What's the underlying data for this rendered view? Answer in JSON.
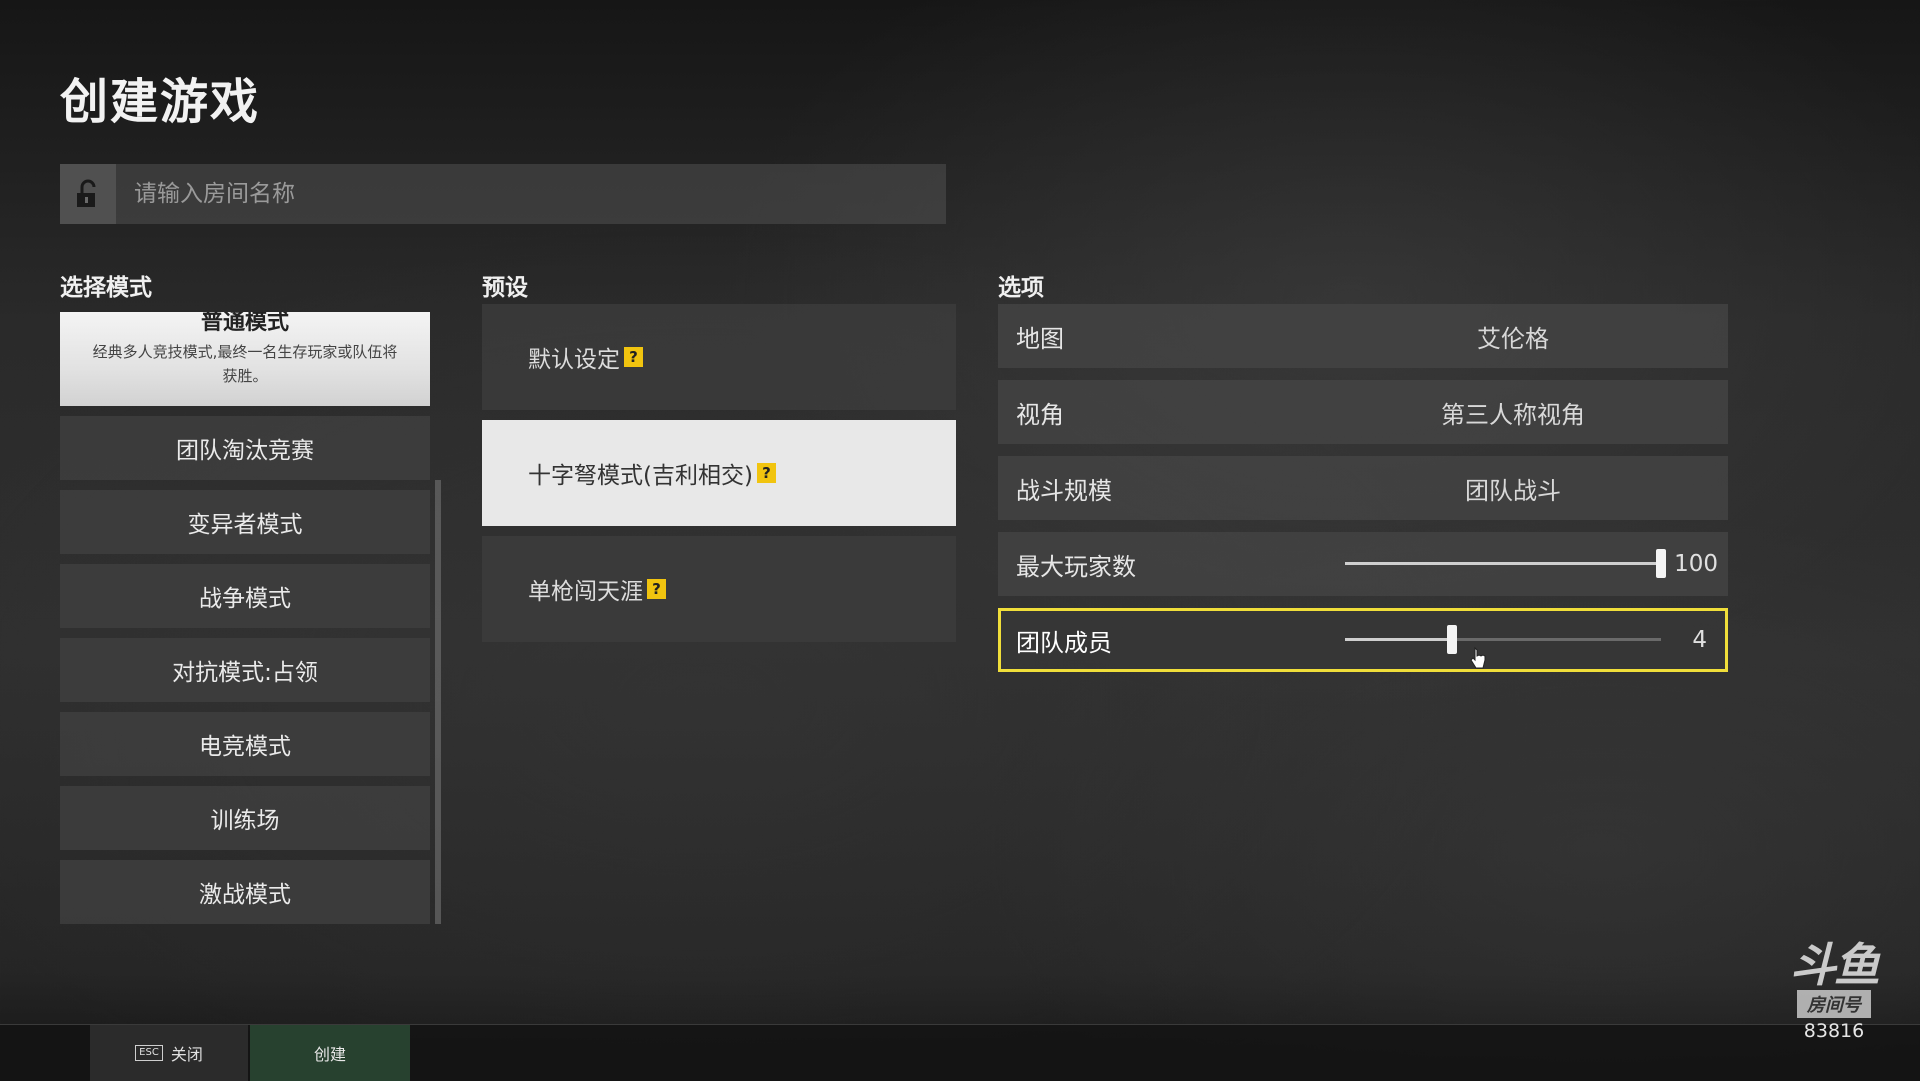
{
  "header": {
    "title": "创建游戏"
  },
  "room": {
    "placeholder": "请输入房间名称",
    "value": ""
  },
  "modes": {
    "title": "选择模式",
    "featured": {
      "title": "普通模式",
      "description": "经典多人竞技模式,最终一名生存玩家或队伍将获胜。"
    },
    "items": [
      "团队淘汰竞赛",
      "变异者模式",
      "战争模式",
      "对抗模式:占领",
      "电竞模式",
      "训练场",
      "激战模式"
    ]
  },
  "presets": {
    "title": "预设",
    "items": [
      {
        "label": "默认设定",
        "help": "?"
      },
      {
        "label": "十字弩模式(吉利相交)",
        "help": "?"
      },
      {
        "label": "单枪闯天涯",
        "help": "?"
      }
    ],
    "active_index": 1
  },
  "options": {
    "title": "选项",
    "map": {
      "label": "地图",
      "value": "艾伦格"
    },
    "perspective": {
      "label": "视角",
      "value": "第三人称视角"
    },
    "scale": {
      "label": "战斗规模",
      "value": "团队战斗"
    },
    "max_players": {
      "label": "最大玩家数",
      "value": "100",
      "fraction": 1.0
    },
    "team_members": {
      "label": "团队成员",
      "value": "4",
      "fraction": 0.34
    }
  },
  "bottom_bar": {
    "esc_key": "ESC",
    "close_label": "关闭",
    "create_label": "创建"
  },
  "watermark": {
    "logo": "斗鱼",
    "badge": "房间号",
    "room_number": "83816"
  },
  "colors": {
    "highlight": "#f0de3a",
    "help_badge": "#f1c40f",
    "create_button": "#27412f"
  }
}
